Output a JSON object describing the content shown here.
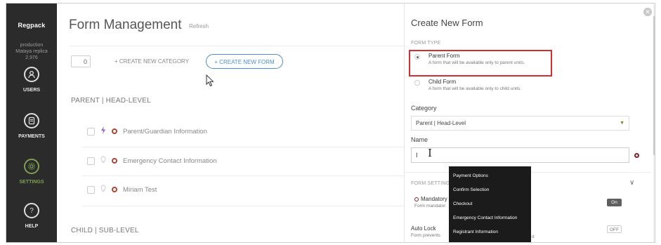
{
  "sidebar": {
    "logo": "Regpack",
    "env_name": "production",
    "env_user": "Mataya replica",
    "env_id": "2,976",
    "items": [
      {
        "label": "USERS",
        "icon": "user-icon"
      },
      {
        "label": "PAYMENTS",
        "icon": "payments-icon"
      },
      {
        "label": "SETTINGS",
        "icon": "gear-icon"
      },
      {
        "label": "HELP",
        "icon": "help-icon",
        "glyph": "?"
      }
    ],
    "active_color": "#7ea04e"
  },
  "main": {
    "title": "Form Management",
    "refresh": "Refresh",
    "count": "0",
    "create_category": "+ CREATE NEW CATEGORY",
    "create_form": "+ CREATE NEW FORM",
    "sections": [
      {
        "title": "PARENT | HEAD-LEVEL",
        "forms": [
          {
            "label": "Parent/Guardian Information",
            "icon": "bolt-icon"
          },
          {
            "label": "Emergency Contact Information",
            "icon": "bulb-icon"
          },
          {
            "label": "Miriam Test",
            "icon": "bulb-icon"
          }
        ]
      },
      {
        "title": "CHILD | SUB-LEVEL"
      }
    ]
  },
  "panel": {
    "title": "Create New Form",
    "close": "✕",
    "form_type_label": "FORM TYPE",
    "form_types": [
      {
        "title": "Parent Form",
        "desc": "A form that will be available only to parent units.",
        "selected": true
      },
      {
        "title": "Child Form",
        "desc": "A form that will be available only to child units.",
        "selected": false
      }
    ],
    "category_label": "Category",
    "category_value": "Parent | Head-Level",
    "name_label": "Name",
    "name_value": "I",
    "dropdown_options": [
      "Payment Options",
      "Confirm Selection",
      "Checkout",
      "Emergency Contact Information",
      "Registrant Information"
    ],
    "form_settings_label": "FORM SETTING",
    "settings": [
      {
        "title": "Mandatory",
        "desc": "Form mandator",
        "toggle": "On"
      },
      {
        "title": "Auto Lock",
        "desc": "Form prevents",
        "desc_tail": "d",
        "toggle": "OFF"
      }
    ],
    "highlight_color": "#d62d2d"
  }
}
